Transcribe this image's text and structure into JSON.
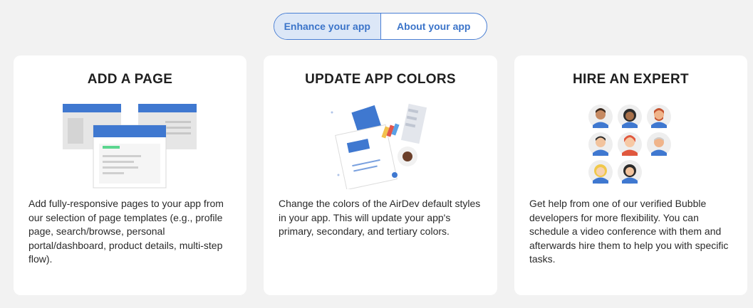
{
  "tabs": {
    "enhance": "Enhance your app",
    "about": "About your app"
  },
  "cards": [
    {
      "title": "ADD A PAGE",
      "description": "Add fully-responsive pages to your app from our selection of page templates (e.g., profile page, search/browse, personal portal/dashboard, product details, multi-step flow)."
    },
    {
      "title": "UPDATE APP COLORS",
      "description": "Change the colors of the AirDev default styles in your app. This will update your app's primary, secondary, and tertiary colors."
    },
    {
      "title": "HIRE AN EXPERT",
      "description": "Get help from one of our verified Bubble developers for more flexibility. You can schedule a video conference with them and afterwards hire them to help you with specific tasks."
    }
  ],
  "colors": {
    "accent": "#3b74c9",
    "background": "#f2f2f2"
  }
}
